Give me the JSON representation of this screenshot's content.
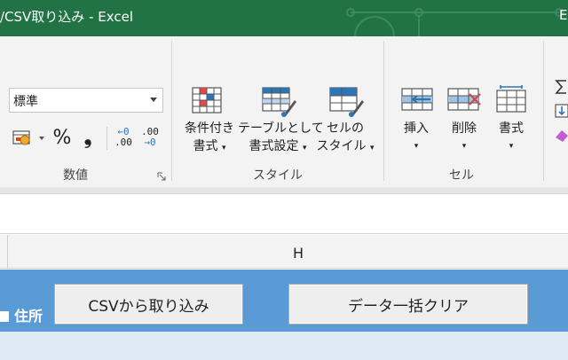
{
  "titlebar": {
    "title": "/CSV取り込み  -  Excel",
    "right_char": "E",
    "bg_color": "#217346"
  },
  "ribbon": {
    "number_group": {
      "format_value": "標準",
      "percent": "%",
      "comma": "❟",
      "inc_decimal_top": "←0",
      "inc_decimal_bottom": ".00",
      "dec_decimal_top": ".00",
      "dec_decimal_bottom": "→0",
      "label": "数値"
    },
    "style_group": {
      "conditional_line1": "条件付き",
      "conditional_line2": "書式",
      "table_line1": "テーブルとして",
      "table_line2": "書式設定",
      "cell_style_line1": "セルの",
      "cell_style_line2": "スタイル",
      "label": "スタイル"
    },
    "cells_group": {
      "insert": "挿入",
      "delete": "削除",
      "format": "書式",
      "label": "セル"
    },
    "icons": [
      "accounting-format-icon",
      "percent-icon",
      "comma-icon",
      "increase-decimal-icon",
      "decrease-decimal-icon",
      "conditional-format-icon",
      "format-as-table-icon",
      "cell-styles-icon",
      "insert-cells-icon",
      "delete-cells-icon",
      "format-cells-icon",
      "autosum-icon",
      "fill-icon",
      "clear-icon"
    ]
  },
  "sheet": {
    "column_header": "H",
    "address_label": "住所",
    "import_button": "CSVから取り込み",
    "clear_button": "データ一括クリア",
    "header_color": "#5b9bd5",
    "row_color": "#deeaf6"
  }
}
